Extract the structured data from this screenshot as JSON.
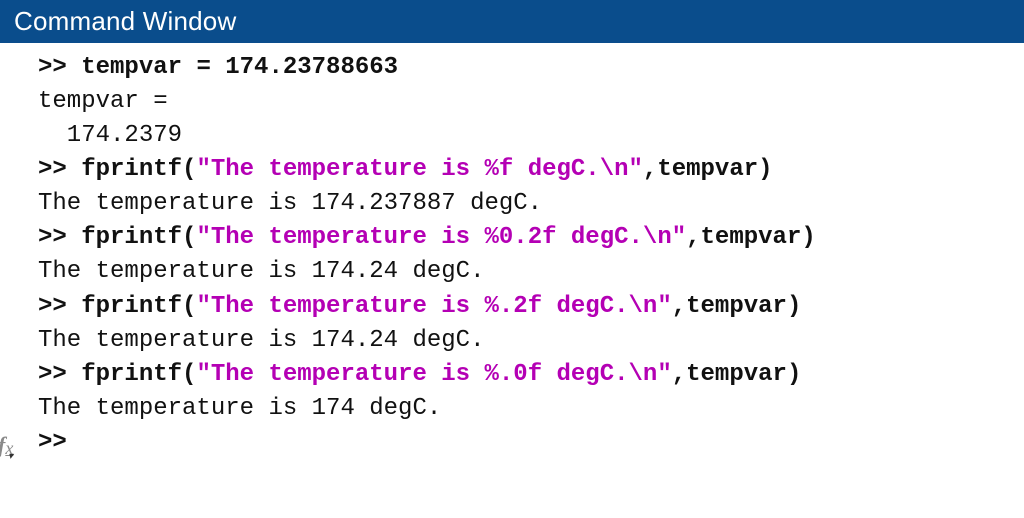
{
  "title": "Command Window",
  "prompt": ">> ",
  "lines": {
    "l1_input": "tempvar = 174.23788663",
    "l2_out": "tempvar =",
    "l3_out": "  174.2379",
    "l4_code_pre": "fprintf(",
    "l4_str": "\"The temperature is %f degC.\\n\"",
    "l4_code_post": ",tempvar)",
    "l5_out": "The temperature is 174.237887 degC.",
    "l6_code_pre": "fprintf(",
    "l6_str": "\"The temperature is %0.2f degC.\\n\"",
    "l6_code_post": ",tempvar)",
    "l7_out": "The temperature is 174.24 degC.",
    "l8_code_pre": "fprintf(",
    "l8_str": "\"The temperature is %.2f degC.\\n\"",
    "l8_code_post": ",tempvar)",
    "l9_out": "The temperature is 174.24 degC.",
    "l10_code_pre": "fprintf(",
    "l10_str": "\"The temperature is %.0f degC.\\n\"",
    "l10_code_post": ",tempvar)",
    "l11_out": "The temperature is 174 degC.",
    "cursor_prompt": ">>"
  },
  "fx": {
    "f": "f",
    "x": "x",
    "arrow": "▾"
  }
}
